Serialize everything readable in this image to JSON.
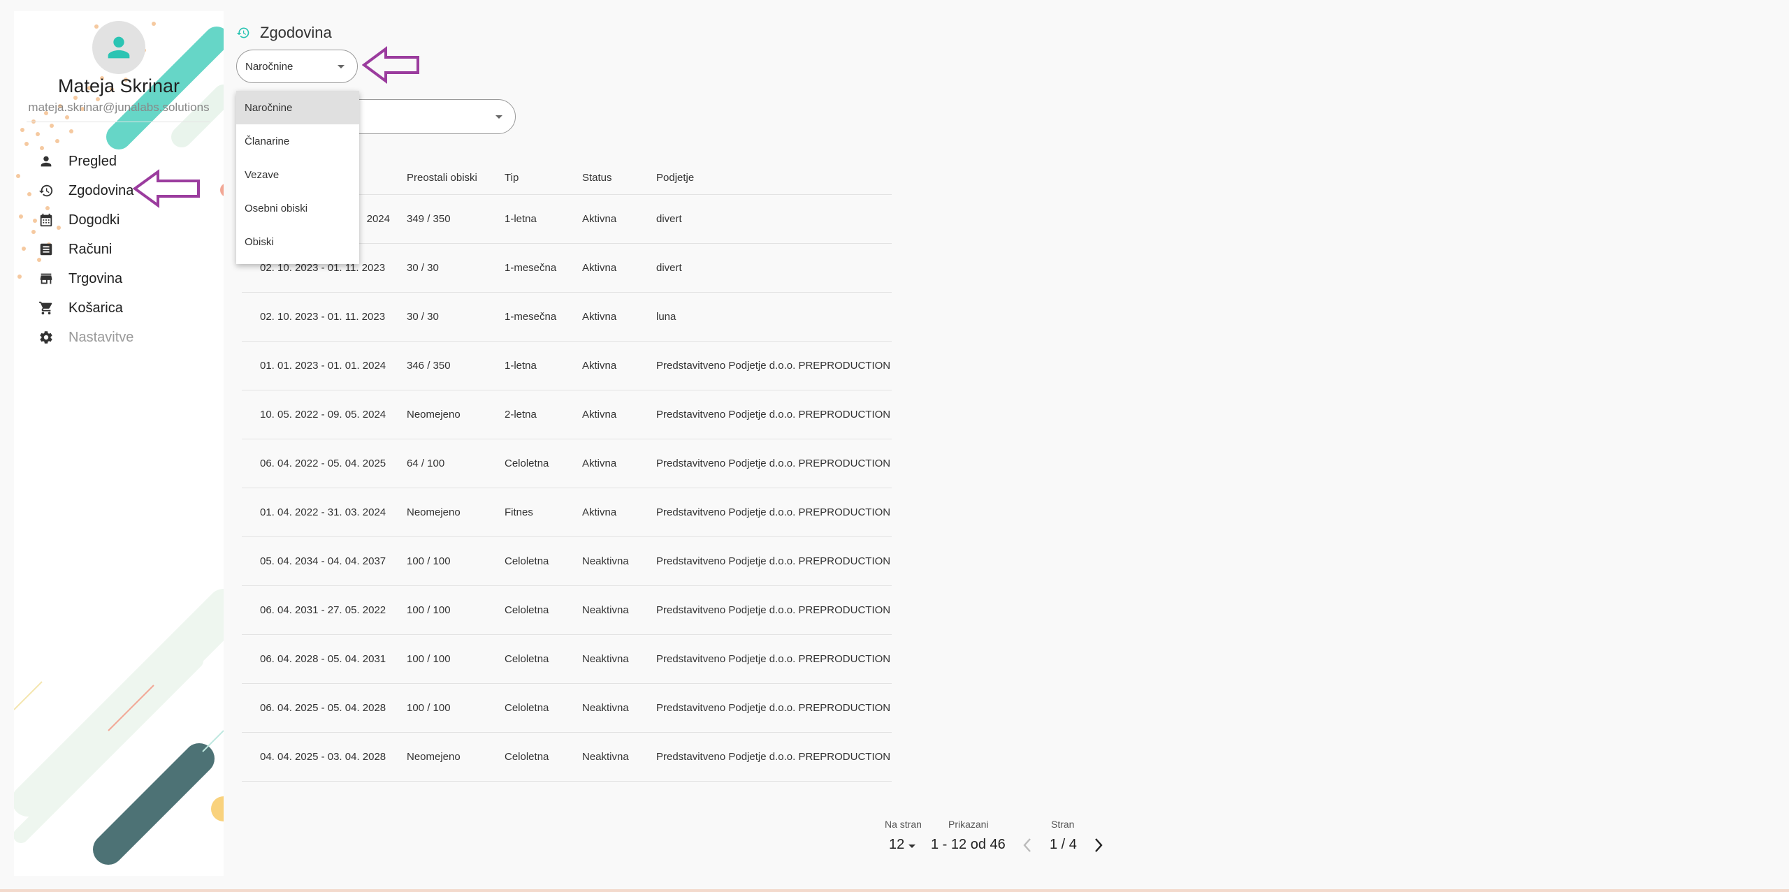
{
  "user": {
    "name": "Mateja Skrinar",
    "email": "mateja.skrinar@junalabs.solutions"
  },
  "nav": {
    "items": [
      {
        "label": "Pregled",
        "icon": "person-icon"
      },
      {
        "label": "Zgodovina",
        "icon": "history-icon"
      },
      {
        "label": "Dogodki",
        "icon": "calendar-icon"
      },
      {
        "label": "Računi",
        "icon": "receipt-icon"
      },
      {
        "label": "Trgovina",
        "icon": "store-icon"
      },
      {
        "label": "Košarica",
        "icon": "cart-icon"
      },
      {
        "label": "Nastavitve",
        "icon": "gear-icon",
        "disabled": true
      }
    ]
  },
  "header": {
    "title": "Zgodovina",
    "icon": "history-icon"
  },
  "filter": {
    "selected": "Naročnine",
    "options": [
      "Naročnine",
      "Članarine",
      "Vezave",
      "Osebni obiski",
      "Obiski"
    ]
  },
  "table": {
    "headers": [
      "",
      "Preostali obiski",
      "Tip",
      "Status",
      "Podjetje"
    ],
    "rows": [
      [
        "2024",
        "349 / 350",
        "1-letna",
        "Aktivna",
        "divert"
      ],
      [
        "02. 10. 2023 - 01. 11. 2023",
        "30 / 30",
        "1-mesečna",
        "Aktivna",
        "divert"
      ],
      [
        "02. 10. 2023 - 01. 11. 2023",
        "30 / 30",
        "1-mesečna",
        "Aktivna",
        "luna"
      ],
      [
        "01. 01. 2023 - 01. 01. 2024",
        "346 / 350",
        "1-letna",
        "Aktivna",
        "Predstavitveno Podjetje d.o.o. PREPRODUCTION"
      ],
      [
        "10. 05. 2022 - 09. 05. 2024",
        "Neomejeno",
        "2-letna",
        "Aktivna",
        "Predstavitveno Podjetje d.o.o. PREPRODUCTION"
      ],
      [
        "06. 04. 2022 - 05. 04. 2025",
        "64 / 100",
        "Celoletna",
        "Aktivna",
        "Predstavitveno Podjetje d.o.o. PREPRODUCTION"
      ],
      [
        "01. 04. 2022 - 31. 03. 2024",
        "Neomejeno",
        "Fitnes",
        "Aktivna",
        "Predstavitveno Podjetje d.o.o. PREPRODUCTION"
      ],
      [
        "05. 04. 2034 - 04. 04. 2037",
        "100 / 100",
        "Celoletna",
        "Neaktivna",
        "Predstavitveno Podjetje d.o.o. PREPRODUCTION"
      ],
      [
        "06. 04. 2031 - 27. 05. 2022",
        "100 / 100",
        "Celoletna",
        "Neaktivna",
        "Predstavitveno Podjetje d.o.o. PREPRODUCTION"
      ],
      [
        "06. 04. 2028 - 05. 04. 2031",
        "100 / 100",
        "Celoletna",
        "Neaktivna",
        "Predstavitveno Podjetje d.o.o. PREPRODUCTION"
      ],
      [
        "06. 04. 2025 - 05. 04. 2028",
        "100 / 100",
        "Celoletna",
        "Neaktivna",
        "Predstavitveno Podjetje d.o.o. PREPRODUCTION"
      ],
      [
        "04. 04. 2025 - 03. 04. 2028",
        "Neomejeno",
        "Celoletna",
        "Neaktivna",
        "Predstavitveno Podjetje d.o.o. PREPRODUCTION"
      ]
    ]
  },
  "pagination": {
    "per_page_label": "Na stran",
    "per_page_value": "12",
    "shown_label": "Prikazani",
    "shown_value": "1 - 12 od 46",
    "page_label": "Stran",
    "page_value": "1 / 4"
  },
  "colors": {
    "accent_teal": "#2bc4b3",
    "annotation_purple": "#9b3c9e",
    "deco_dark_teal": "#4d7275",
    "deco_peach": "#f5c9a0"
  }
}
